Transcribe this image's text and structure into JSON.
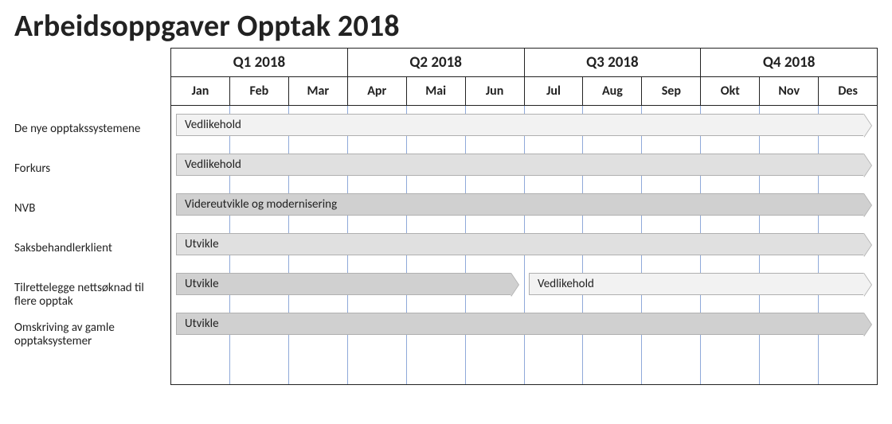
{
  "title": "Arbeidsoppgaver Opptak 2018",
  "quarters": [
    "Q1 2018",
    "Q2 2018",
    "Q3 2018",
    "Q4 2018"
  ],
  "months": [
    "Jan",
    "Feb",
    "Mar",
    "Apr",
    "Mai",
    "Jun",
    "Jul",
    "Aug",
    "Sep",
    "Okt",
    "Nov",
    "Des"
  ],
  "rows": [
    {
      "label": "De nye opptakssystemene",
      "bars": [
        {
          "label": "Vedlikehold",
          "start": 0,
          "end": 12,
          "shade": "lt"
        }
      ]
    },
    {
      "label": "Forkurs",
      "bars": [
        {
          "label": "Vedlikehold",
          "start": 0,
          "end": 12,
          "shade": "md"
        }
      ]
    },
    {
      "label": "NVB",
      "bars": [
        {
          "label": "Videreutvikle og modernisering",
          "start": 0,
          "end": 12,
          "shade": "dk"
        }
      ]
    },
    {
      "label": "Saksbehandlerklient",
      "bars": [
        {
          "label": "Utvikle",
          "start": 0,
          "end": 12,
          "shade": "md"
        }
      ]
    },
    {
      "label": "Tilrettelegge nettsøknad til flere opptak",
      "bars": [
        {
          "label": "Utvikle",
          "start": 0,
          "end": 6,
          "shade": "dk"
        },
        {
          "label": "Vedlikehold",
          "start": 6,
          "end": 12,
          "shade": "lt"
        }
      ]
    },
    {
      "label": "Omskriving av gamle opptaksystemer",
      "bars": [
        {
          "label": "Utvikle",
          "start": 0,
          "end": 12,
          "shade": "dk"
        }
      ]
    }
  ],
  "chart_data": {
    "type": "bar",
    "title": "Arbeidsoppgaver Opptak 2018",
    "xlabel": "2018",
    "ylabel": "",
    "x_ticks_major": [
      "Q1 2018",
      "Q2 2018",
      "Q3 2018",
      "Q4 2018"
    ],
    "x_ticks_minor": [
      "Jan",
      "Feb",
      "Mar",
      "Apr",
      "Mai",
      "Jun",
      "Jul",
      "Aug",
      "Sep",
      "Okt",
      "Nov",
      "Des"
    ],
    "categories": [
      "De nye opptakssystemene",
      "Forkurs",
      "NVB",
      "Saksbehandlerklient",
      "Tilrettelegge nettsøknad til flere opptak",
      "Omskriving av gamle opptaksystemer"
    ],
    "series": [
      {
        "name": "De nye opptakssystemene",
        "segments": [
          {
            "activity": "Vedlikehold",
            "start_month": 1,
            "end_month": 12
          }
        ]
      },
      {
        "name": "Forkurs",
        "segments": [
          {
            "activity": "Vedlikehold",
            "start_month": 1,
            "end_month": 12
          }
        ]
      },
      {
        "name": "NVB",
        "segments": [
          {
            "activity": "Videreutvikle og modernisering",
            "start_month": 1,
            "end_month": 12
          }
        ]
      },
      {
        "name": "Saksbehandlerklient",
        "segments": [
          {
            "activity": "Utvikle",
            "start_month": 1,
            "end_month": 12
          }
        ]
      },
      {
        "name": "Tilrettelegge nettsøknad til flere opptak",
        "segments": [
          {
            "activity": "Utvikle",
            "start_month": 1,
            "end_month": 6
          },
          {
            "activity": "Vedlikehold",
            "start_month": 7,
            "end_month": 12
          }
        ]
      },
      {
        "name": "Omskriving av gamle opptaksystemer",
        "segments": [
          {
            "activity": "Utvikle",
            "start_month": 1,
            "end_month": 12
          }
        ]
      }
    ],
    "xlim": [
      1,
      12
    ]
  }
}
